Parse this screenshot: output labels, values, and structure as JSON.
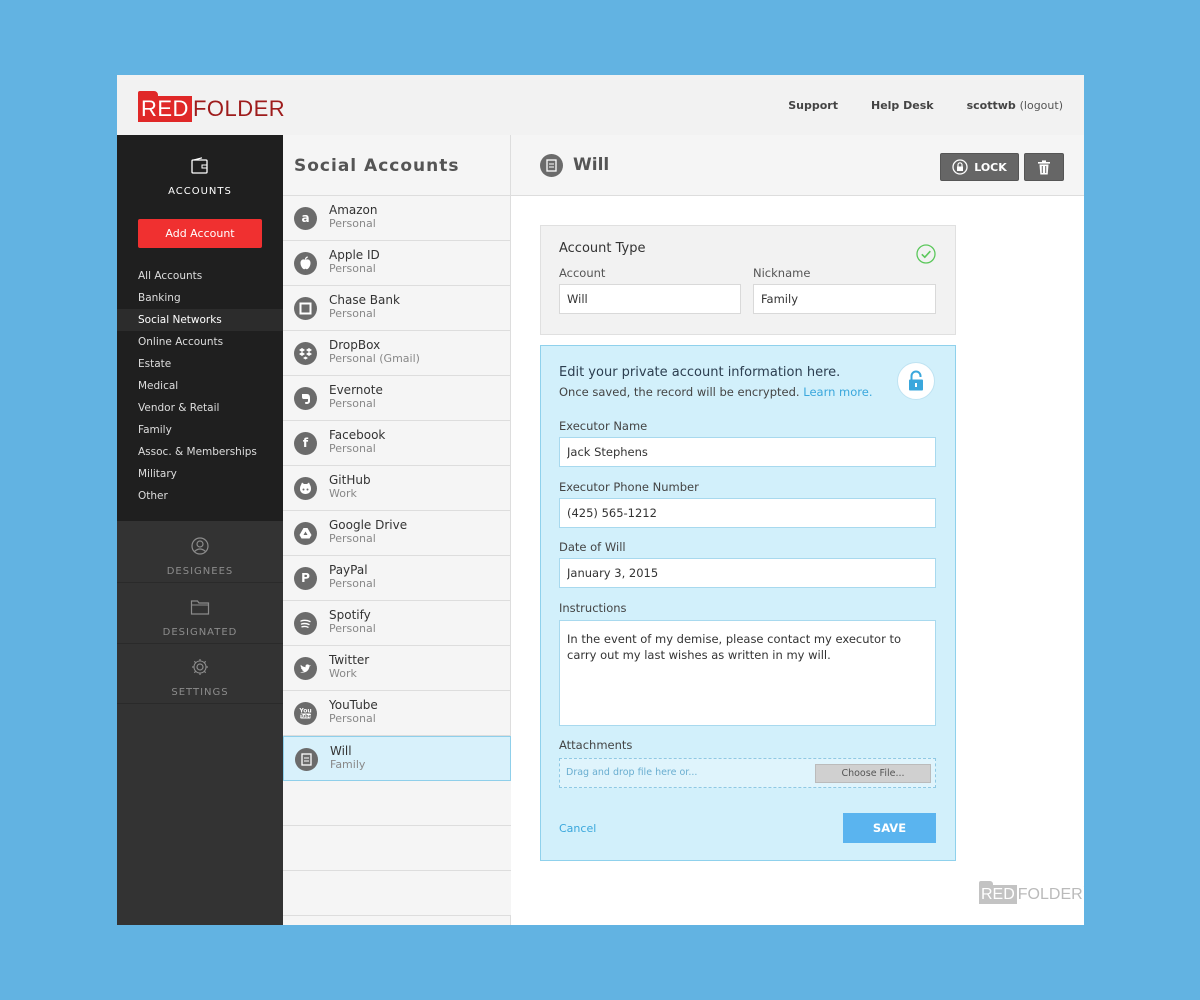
{
  "header": {
    "logo_red": "RED",
    "logo_dark": "FOLDER",
    "nav": {
      "support": "Support",
      "help_desk": "Help Desk",
      "username": "scottwb",
      "logout": "(logout)"
    }
  },
  "sidebar": {
    "accounts_label": "ACCOUNTS",
    "add_account": "Add Account",
    "categories": [
      "All Accounts",
      "Banking",
      "Social Networks",
      "Online Accounts",
      "Estate",
      "Medical",
      "Vendor & Retail",
      "Family",
      "Assoc. & Memberships",
      "Military",
      "Other"
    ],
    "active_category": "Social Networks",
    "designees_label": "DESIGNEES",
    "designated_label": "DESIGNATED",
    "settings_label": "SETTINGS"
  },
  "list": {
    "title": "Social Accounts",
    "items": [
      {
        "name": "Amazon",
        "sub": "Personal",
        "icon": "amazon-icon",
        "glyph": "a"
      },
      {
        "name": "Apple ID",
        "sub": "Personal",
        "icon": "apple-icon",
        "glyph": ""
      },
      {
        "name": "Chase Bank",
        "sub": "Personal",
        "icon": "chase-icon",
        "glyph": ""
      },
      {
        "name": "DropBox",
        "sub": "Personal (Gmail)",
        "icon": "dropbox-icon",
        "glyph": ""
      },
      {
        "name": "Evernote",
        "sub": "Personal",
        "icon": "evernote-icon",
        "glyph": ""
      },
      {
        "name": "Facebook",
        "sub": "Personal",
        "icon": "facebook-icon",
        "glyph": "f"
      },
      {
        "name": "GitHub",
        "sub": "Work",
        "icon": "github-icon",
        "glyph": ""
      },
      {
        "name": "Google Drive",
        "sub": "Personal",
        "icon": "google-drive-icon",
        "glyph": ""
      },
      {
        "name": "PayPal",
        "sub": "Personal",
        "icon": "paypal-icon",
        "glyph": "P"
      },
      {
        "name": "Spotify",
        "sub": "Personal",
        "icon": "spotify-icon",
        "glyph": ""
      },
      {
        "name": "Twitter",
        "sub": "Work",
        "icon": "twitter-icon",
        "glyph": ""
      },
      {
        "name": "YouTube",
        "sub": "Personal",
        "icon": "youtube-icon",
        "glyph": ""
      },
      {
        "name": "Will",
        "sub": "Family",
        "icon": "will-icon",
        "glyph": "",
        "selected": true
      }
    ]
  },
  "detail": {
    "title": "Will",
    "lock_label": "LOCK",
    "account_type": {
      "title": "Account Type",
      "account_label": "Account",
      "account_value": "Will",
      "nickname_label": "Nickname",
      "nickname_value": "Family"
    },
    "private": {
      "title": "Edit your private account information here.",
      "subtitle": "Once saved, the record will be encrypted.",
      "learn_more": "Learn more.",
      "executor_name_label": "Executor Name",
      "executor_name_value": "Jack Stephens",
      "executor_phone_label": "Executor Phone Number",
      "executor_phone_value": "(425) 565-1212",
      "date_label": "Date of Will",
      "date_value": "January 3, 2015",
      "instructions_label": "Instructions",
      "instructions_value": "In the event of my demise, please contact my executor to carry out my last wishes as written in my will.",
      "attachments_label": "Attachments",
      "drop_text": "Drag and drop file here or...",
      "choose_file": "Choose File...",
      "cancel": "Cancel",
      "save": "SAVE"
    }
  },
  "footer": {
    "logo_red": "RED",
    "logo_dark": "FOLDER",
    "tm": "™"
  },
  "colors": {
    "brand_red": "#e02828",
    "accent_blue": "#5ab4ef",
    "sidebar_dark": "#1f1f1f",
    "page_bg": "#62b3e2"
  }
}
